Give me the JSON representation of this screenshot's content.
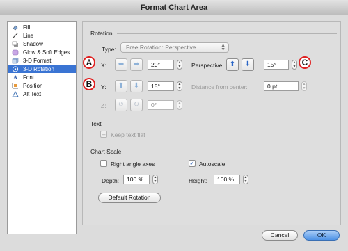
{
  "window": {
    "title": "Format Chart Area"
  },
  "sidebar": {
    "items": [
      {
        "label": "Fill",
        "icon": "paint-bucket-icon",
        "selected": false
      },
      {
        "label": "Line",
        "icon": "pen-icon",
        "selected": false
      },
      {
        "label": "Shadow",
        "icon": "shadow-icon",
        "selected": false
      },
      {
        "label": "Glow & Soft Edges",
        "icon": "glow-icon",
        "selected": false
      },
      {
        "label": "3-D Format",
        "icon": "3d-format-icon",
        "selected": false
      },
      {
        "label": "3-D Rotation",
        "icon": "3d-rotation-icon",
        "selected": true
      },
      {
        "label": "Font",
        "icon": "font-icon",
        "selected": false
      },
      {
        "label": "Position",
        "icon": "position-icon",
        "selected": false
      },
      {
        "label": "Alt Text",
        "icon": "alt-text-icon",
        "selected": false
      }
    ]
  },
  "rotation": {
    "section_title": "Rotation",
    "type_label": "Type:",
    "type_value": "Free Rotation: Perspective",
    "x_label": "X:",
    "x_value": "20°",
    "y_label": "Y:",
    "y_value": "15°",
    "z_label": "Z:",
    "z_value": "0°",
    "perspective_label": "Perspective:",
    "perspective_value": "15°",
    "distance_label": "Distance from center:",
    "distance_value": "0 pt"
  },
  "text_section": {
    "section_title": "Text",
    "keep_flat_label": "Keep text flat"
  },
  "chart_scale": {
    "section_title": "Chart Scale",
    "right_angle_label": "Right angle axes",
    "right_angle_checked": false,
    "autoscale_label": "Autoscale",
    "autoscale_checked": true,
    "depth_label": "Depth:",
    "depth_value": "100 %",
    "height_label": "Height:",
    "height_value": "100 %",
    "default_rotation_label": "Default Rotation"
  },
  "callouts": {
    "a": "A",
    "b": "B",
    "c": "C"
  },
  "footer": {
    "cancel_label": "Cancel",
    "ok_label": "OK"
  },
  "colors": {
    "selection": "#3a74d3",
    "callout_border": "#e02121",
    "ok_button": "#4f93e6"
  }
}
